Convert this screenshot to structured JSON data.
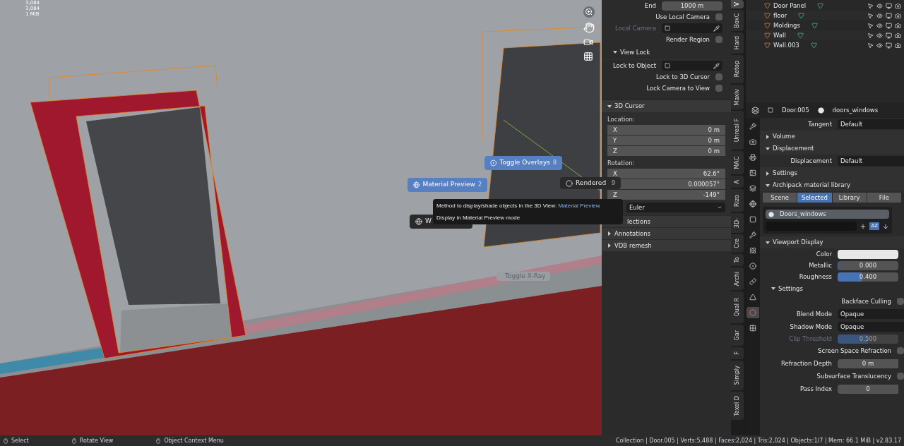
{
  "viewport": {
    "stats": [
      "3,084",
      "3,084",
      "1 MiB"
    ]
  },
  "pie_menu": {
    "items": [
      {
        "kind": "overlays",
        "label": "Toggle Overlays",
        "shortcut": "8",
        "selected": true
      },
      {
        "kind": "material",
        "label": "Material Preview",
        "shortcut": "2",
        "selected": true
      },
      {
        "kind": "rendered",
        "label": "Rendered",
        "shortcut": "9",
        "selected": false
      },
      {
        "kind": "wireframe",
        "label": "W",
        "selected": false
      },
      {
        "kind": "xray",
        "label": "Toggle X-Ray",
        "selected": false
      }
    ]
  },
  "tooltip": {
    "text": "Method to display/shade objects in the 3D View:",
    "value": "Material Preview",
    "description": "Display in Material Preview mode"
  },
  "n_panel": {
    "view_rows": [
      {
        "kind": "field",
        "label": "End",
        "value": "1000 m"
      },
      {
        "kind": "checkbox",
        "label": "Use Local Camera",
        "checked": false
      },
      {
        "kind": "picker",
        "label": "Local Camera",
        "disabled": true
      },
      {
        "kind": "checkbox",
        "label": "Render Region",
        "checked": false
      },
      {
        "kind": "subheader",
        "label": "View Lock",
        "expanded": true
      },
      {
        "kind": "picker",
        "label": "Lock to Object",
        "disabled": false
      },
      {
        "kind": "checkbox",
        "label": "Lock to 3D Cursor",
        "checked": false
      },
      {
        "kind": "checkbox",
        "label": "Lock Camera to View",
        "checked": false
      }
    ],
    "cursor": {
      "title": "3D Cursor",
      "expanded": true,
      "location_label": "Location:",
      "location": [
        {
          "label": "X",
          "value": "0 m"
        },
        {
          "label": "Y",
          "value": "0 m"
        },
        {
          "label": "Z",
          "value": "0 m"
        }
      ],
      "rotation_label": "Rotation:",
      "rotation": [
        {
          "label": "X",
          "value": "62.6°"
        },
        {
          "value": "0.000057°"
        },
        {
          "label": "Z",
          "value": "-149°"
        }
      ],
      "mode": "Euler"
    },
    "panels": [
      {
        "label": "lections"
      },
      {
        "label": "Annotations"
      },
      {
        "label": "VDB remesh"
      }
    ]
  },
  "side_tabs": [
    {
      "label": "V",
      "selected": true
    },
    {
      "label": "BoxC",
      "selected": false
    },
    {
      "label": "Hard",
      "selected": false
    },
    {
      "label": "Retop",
      "selected": false
    },
    {
      "label": "Maxiv",
      "selected": false
    },
    {
      "label": "Unreal F",
      "selected": false
    },
    {
      "label": "MAC",
      "selected": false
    },
    {
      "label": "A",
      "selected": false
    },
    {
      "label": "Rizo",
      "selected": false
    },
    {
      "label": "3D-",
      "selected": false
    },
    {
      "label": "Cre",
      "selected": false
    },
    {
      "label": "To",
      "selected": false
    },
    {
      "label": "Archi",
      "selected": false
    },
    {
      "label": "Qual R",
      "selected": false
    },
    {
      "label": "Gar",
      "selected": false
    },
    {
      "label": "F",
      "selected": false
    },
    {
      "label": "Simply",
      "selected": false
    },
    {
      "label": "Texel D",
      "selected": false
    }
  ],
  "outliner": {
    "rows": [
      {
        "name": "Door Panel"
      },
      {
        "name": "floor"
      },
      {
        "name": "Moldings"
      },
      {
        "name": "Wall"
      },
      {
        "name": "Wall.003"
      }
    ]
  },
  "properties": {
    "object": "Door.005",
    "material": "doors_windows",
    "tabs": [
      {
        "kind": "tool",
        "selected": false
      },
      {
        "kind": "render",
        "selected": false
      },
      {
        "kind": "output",
        "selected": false
      },
      {
        "kind": "view",
        "selected": false
      },
      {
        "kind": "scene",
        "selected": false
      },
      {
        "kind": "world",
        "selected": false
      },
      {
        "kind": "object",
        "selected": false
      },
      {
        "kind": "modifier",
        "selected": false
      },
      {
        "kind": "particles",
        "selected": false
      },
      {
        "kind": "physics",
        "selected": false
      },
      {
        "kind": "constraints",
        "selected": false
      },
      {
        "kind": "data",
        "selected": false
      },
      {
        "kind": "material",
        "selected": true
      },
      {
        "kind": "texture",
        "selected": false
      }
    ],
    "rows": [
      {
        "kind": "dropdown",
        "label": "Tangent",
        "value": "Default"
      },
      {
        "kind": "panel",
        "label": "Volume",
        "expanded": false
      },
      {
        "kind": "panel",
        "label": "Displacement",
        "expanded": true
      },
      {
        "kind": "dropdown",
        "label": "Displacement",
        "value": "Default"
      },
      {
        "kind": "panel",
        "label": "Settings",
        "expanded": false
      },
      {
        "kind": "panel",
        "label": "Archipack material library",
        "expanded": true
      },
      {
        "kind": "segmented",
        "options": [
          {
            "label": "Scene",
            "selected": false
          },
          {
            "label": "Selected",
            "selected": true
          },
          {
            "label": "Library",
            "selected": false
          },
          {
            "label": "File",
            "selected": false
          }
        ]
      },
      {
        "kind": "list",
        "items": [
          {
            "name": "Doors_windows",
            "selected": true
          }
        ],
        "sort_label": "AZ"
      },
      {
        "kind": "panel",
        "label": "Viewport Display",
        "expanded": true
      },
      {
        "kind": "color",
        "label": "Color",
        "color": "#e8e8e8"
      },
      {
        "kind": "slider",
        "label": "Metallic",
        "value": "0.000",
        "level": 0,
        "disabled": false
      },
      {
        "kind": "slider",
        "label": "Roughness",
        "value": "0.400",
        "level": 0.4,
        "disabled": false
      },
      {
        "kind": "subpanel",
        "label": "Settings",
        "expanded": true
      },
      {
        "kind": "checkbox",
        "label": "Backface Culling",
        "checked": false
      },
      {
        "kind": "dropdown",
        "label": "Blend Mode",
        "value": "Opaque"
      },
      {
        "kind": "dropdown",
        "label": "Shadow Mode",
        "value": "Opaque"
      },
      {
        "kind": "slider",
        "label": "Clip Threshold",
        "value": "0.500",
        "level": 0.5,
        "disabled": true
      },
      {
        "kind": "checkbox",
        "label": "Screen Space Refraction",
        "checked": false
      },
      {
        "kind": "number",
        "label": "Refraction Depth",
        "value": "0 m"
      },
      {
        "kind": "checkbox",
        "label": "Subsurface Translucency",
        "checked": false
      },
      {
        "kind": "number",
        "label": "Pass Index",
        "value": "0"
      }
    ]
  },
  "status_bar": {
    "items": [
      {
        "label": "Select"
      },
      {
        "label": "Rotate View"
      },
      {
        "label": "Object Context Menu"
      }
    ],
    "info": "Collection | Door.005 | Verts:5,488 | Faces:2,024 | Tris:2,024 | Objects:1/7 | Mem: 66.1 MiB | v2.83.17"
  }
}
